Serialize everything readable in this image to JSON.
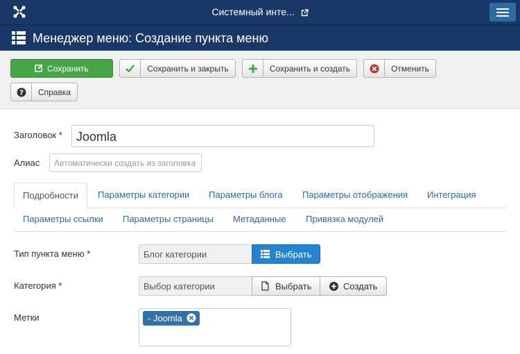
{
  "topbar": {
    "site_title": "Системный инте...",
    "logo_icon": "joomla-logo-icon",
    "external_icon": "external-link-icon",
    "menu_icon": "hamburger-icon"
  },
  "header": {
    "title": "Менеджер меню: Создание пункта меню",
    "icon": "list-icon"
  },
  "toolbar": {
    "save_label": "Сохранить",
    "save_close_label": "Сохранить и закрыть",
    "save_new_label": "Сохранить и создать",
    "cancel_label": "Отменить",
    "help_label": "Справка",
    "colors": {
      "save": "#46a546",
      "check": "#46a546",
      "plus": "#46a546",
      "cancel": "#bd362f"
    }
  },
  "form": {
    "title_label": "Заголовок *",
    "title_value": "Joomla",
    "alias_label": "Алиас",
    "alias_placeholder": "Автоматически создать из заголовка"
  },
  "tabs": {
    "row1": [
      "Подробности",
      "Параметры категории",
      "Параметры блога",
      "Параметры отображения",
      "Интеграция"
    ],
    "row2": [
      "Параметры ссылки",
      "Параметры страницы",
      "Метаданные",
      "Привязка модулей"
    ]
  },
  "details": {
    "menu_type_label": "Тип пункта меню *",
    "menu_type_value": "Блог категории",
    "select_label": "Выбрать",
    "category_label": "Категория *",
    "category_value": "Выбор категории",
    "category_select_label": "Выбрать",
    "create_label": "Создать",
    "tags_label": "Метки",
    "tag_value": "- Joomla"
  }
}
